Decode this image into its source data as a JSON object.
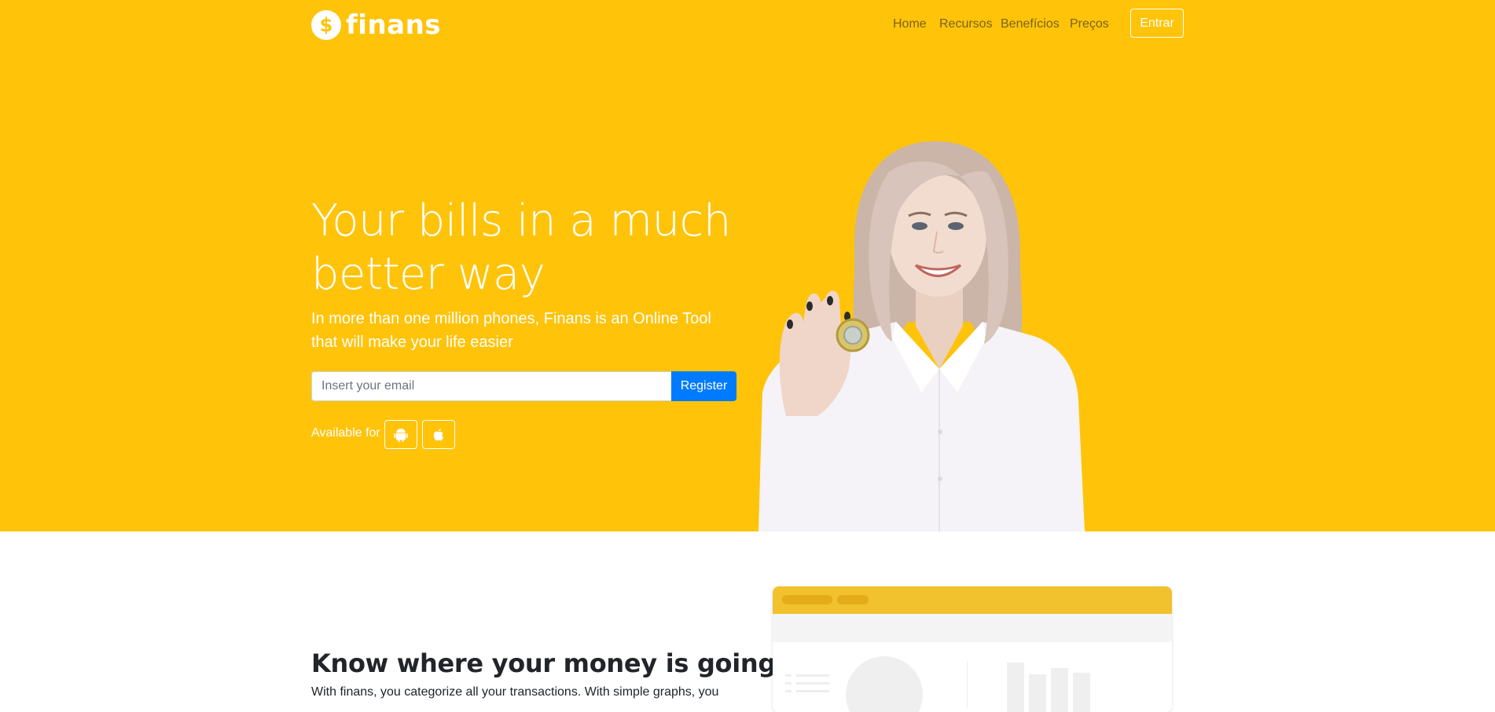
{
  "brand": {
    "icon": "dollar-coin-icon",
    "symbol": "$",
    "name": "finans"
  },
  "nav": {
    "items": [
      "Home",
      "Recursos",
      "Benefícios",
      "Preços"
    ],
    "login_label": "Entrar"
  },
  "hero": {
    "headline_line1": "Your bills in a much",
    "headline_line2": "better way",
    "subheadline": "In more than one million phones, Finans is an Online Tool that will make your life easier",
    "email_placeholder": "Insert your email",
    "register_label": "Register",
    "available_label": "Available for",
    "platforms": [
      "android-icon",
      "apple-icon"
    ]
  },
  "features": {
    "title": "Know where your money is going to",
    "text": "With finans, you categorize all your transactions. With simple graphs, you"
  },
  "colors": {
    "accent": "#ffc30a",
    "primary_button": "#007bff",
    "nav_text": "#7b6413"
  }
}
